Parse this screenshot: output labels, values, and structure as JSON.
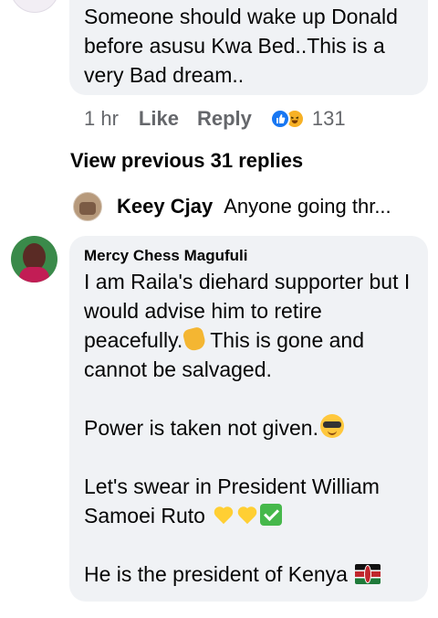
{
  "comment1": {
    "lines": [
      "Someone should wake up Donald",
      "before asusu Kwa Bed..This is a",
      "very Bad dream.."
    ],
    "time": "1 hr",
    "like_label": "Like",
    "reply_label": "Reply",
    "reaction_count": "131",
    "reaction_icons": [
      "like-icon",
      "haha-icon"
    ]
  },
  "replies": {
    "view_previous_label": "View previous 31 replies",
    "preview_author": "Keey Cjay",
    "preview_text": "Anyone going thr..."
  },
  "comment2": {
    "author": "Mercy Chess Magufuli",
    "p1": "I am Raila's diehard supporter but I would advise him to retire peacefully.",
    "p1_rest": " This is gone and cannot be salvaged.",
    "p2": "Power is taken not given.",
    "p3": "Let's swear in President William Samoei Ruto",
    "p4": "He is the president of Kenya",
    "emojis": [
      "ok-hand-icon",
      "cool-face-icon",
      "yellow-heart-icon",
      "check-mark-icon",
      "kenya-flag-icon"
    ]
  },
  "colors": {
    "bubble": "#f0f2f5",
    "muted_text": "#65676b",
    "like_blue": "#1877f2"
  }
}
